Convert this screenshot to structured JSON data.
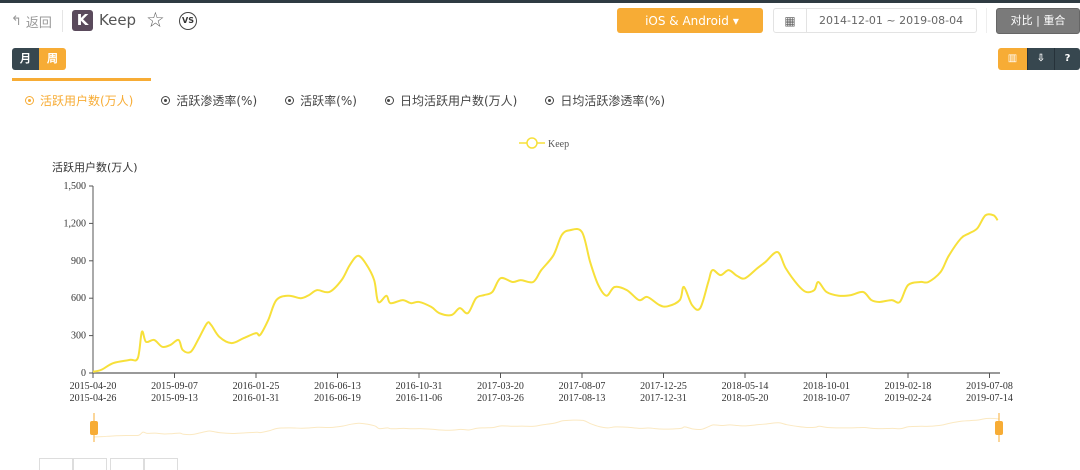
{
  "header": {
    "back_label": "返回",
    "app_name": "Keep",
    "logo_letter": "K",
    "vs_label": "VS",
    "platform_label": "iOS & Android",
    "date_range": "2014-12-01 ~ 2019-08-04",
    "compare_label": "对比 | 重合"
  },
  "periods": {
    "month": "月",
    "week": "周"
  },
  "tools": {
    "chart": "▥",
    "download": "⇩",
    "help": "?"
  },
  "metrics": [
    {
      "label": "活跃用户数(万人)",
      "active": true
    },
    {
      "label": "活跃渗透率(%)"
    },
    {
      "label": "活跃率(%)"
    },
    {
      "label": "日均活跃用户数(万人)"
    },
    {
      "label": "日均活跃渗透率(%)"
    }
  ],
  "colors": {
    "accent": "#f7ac35",
    "line": "#f7e03a",
    "dark": "#37474f"
  },
  "chart_data": {
    "type": "line",
    "title": "",
    "ylabel": "活跃用户数(万人)",
    "legend": [
      "Keep"
    ],
    "legend_position": "top-center",
    "ylim": [
      0,
      1500
    ],
    "yticks": [
      "0",
      "300",
      "600",
      "900",
      "1,200",
      "1,500"
    ],
    "ytick_values": [
      0,
      300,
      600,
      900,
      1200,
      1500
    ],
    "x_unit": "weeks since 2015-04-20",
    "xticks": [
      {
        "week": 0,
        "l1": "2015-04-20",
        "l2": "2015-04-26"
      },
      {
        "week": 20,
        "l1": "2015-09-07",
        "l2": "2015-09-13"
      },
      {
        "week": 40,
        "l1": "2016-01-25",
        "l2": "2016-01-31"
      },
      {
        "week": 60,
        "l1": "2016-06-13",
        "l2": "2016-06-19"
      },
      {
        "week": 80,
        "l1": "2016-10-31",
        "l2": "2016-11-06"
      },
      {
        "week": 100,
        "l1": "2017-03-20",
        "l2": "2017-03-26"
      },
      {
        "week": 120,
        "l1": "2017-08-07",
        "l2": "2017-08-13"
      },
      {
        "week": 140,
        "l1": "2017-12-25",
        "l2": "2017-12-31"
      },
      {
        "week": 160,
        "l1": "2018-05-14",
        "l2": "2018-05-20"
      },
      {
        "week": 180,
        "l1": "2018-10-01",
        "l2": "2018-10-07"
      },
      {
        "week": 200,
        "l1": "2019-02-18",
        "l2": "2019-02-24"
      },
      {
        "week": 220,
        "l1": "2019-07-08",
        "l2": "2019-07-14"
      }
    ],
    "series": [
      {
        "name": "Keep",
        "points": [
          [
            0,
            10
          ],
          [
            2,
            25
          ],
          [
            5,
            80
          ],
          [
            9,
            105
          ],
          [
            11,
            120
          ],
          [
            12,
            330
          ],
          [
            13,
            250
          ],
          [
            15,
            265
          ],
          [
            17,
            210
          ],
          [
            19,
            225
          ],
          [
            21,
            265
          ],
          [
            22,
            185
          ],
          [
            24,
            170
          ],
          [
            26,
            280
          ],
          [
            28,
            400
          ],
          [
            29,
            385
          ],
          [
            31,
            290
          ],
          [
            34,
            240
          ],
          [
            37,
            280
          ],
          [
            40,
            320
          ],
          [
            41,
            305
          ],
          [
            43,
            425
          ],
          [
            45,
            585
          ],
          [
            48,
            620
          ],
          [
            51,
            600
          ],
          [
            53,
            625
          ],
          [
            55,
            665
          ],
          [
            58,
            650
          ],
          [
            61,
            745
          ],
          [
            63,
            865
          ],
          [
            65,
            940
          ],
          [
            67,
            875
          ],
          [
            69,
            745
          ],
          [
            70,
            570
          ],
          [
            72,
            620
          ],
          [
            73,
            560
          ],
          [
            76,
            585
          ],
          [
            78,
            560
          ],
          [
            80,
            570
          ],
          [
            83,
            530
          ],
          [
            85,
            480
          ],
          [
            88,
            465
          ],
          [
            90,
            520
          ],
          [
            92,
            480
          ],
          [
            94,
            600
          ],
          [
            96,
            625
          ],
          [
            98,
            650
          ],
          [
            100,
            760
          ],
          [
            103,
            730
          ],
          [
            105,
            745
          ],
          [
            108,
            730
          ],
          [
            110,
            825
          ],
          [
            113,
            945
          ],
          [
            115,
            1105
          ],
          [
            117,
            1145
          ],
          [
            120,
            1130
          ],
          [
            122,
            890
          ],
          [
            124,
            705
          ],
          [
            126,
            620
          ],
          [
            128,
            690
          ],
          [
            131,
            665
          ],
          [
            134,
            585
          ],
          [
            136,
            610
          ],
          [
            139,
            545
          ],
          [
            141,
            535
          ],
          [
            144,
            585
          ],
          [
            145,
            690
          ],
          [
            147,
            545
          ],
          [
            149,
            520
          ],
          [
            151,
            730
          ],
          [
            152,
            825
          ],
          [
            154,
            785
          ],
          [
            156,
            825
          ],
          [
            158,
            780
          ],
          [
            160,
            760
          ],
          [
            163,
            840
          ],
          [
            165,
            890
          ],
          [
            168,
            970
          ],
          [
            170,
            840
          ],
          [
            173,
            705
          ],
          [
            175,
            650
          ],
          [
            177,
            665
          ],
          [
            178,
            730
          ],
          [
            180,
            650
          ],
          [
            183,
            620
          ],
          [
            186,
            625
          ],
          [
            189,
            650
          ],
          [
            191,
            585
          ],
          [
            193,
            570
          ],
          [
            196,
            585
          ],
          [
            198,
            570
          ],
          [
            200,
            705
          ],
          [
            203,
            730
          ],
          [
            205,
            730
          ],
          [
            208,
            810
          ],
          [
            210,
            940
          ],
          [
            213,
            1080
          ],
          [
            215,
            1120
          ],
          [
            217,
            1160
          ],
          [
            219,
            1265
          ],
          [
            221,
            1265
          ],
          [
            222,
            1225
          ]
        ]
      }
    ]
  }
}
